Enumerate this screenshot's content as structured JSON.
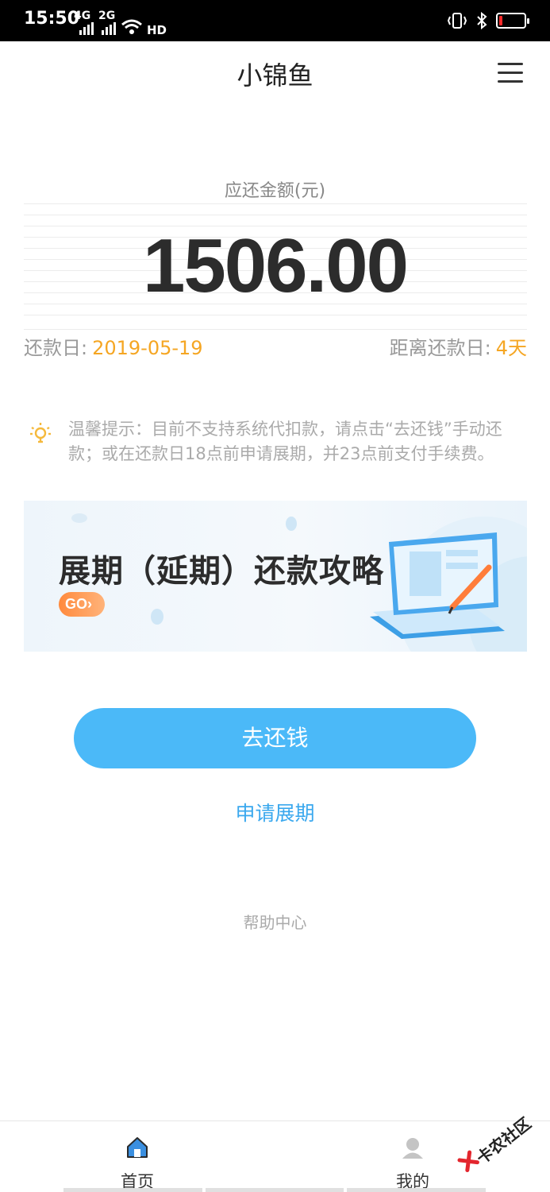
{
  "status_bar": {
    "time": "15:50",
    "signal_1": "4G",
    "signal_2": "2G",
    "hd_label": "HD",
    "battery_level": 0.12,
    "battery_color": "#ff2a2a"
  },
  "header": {
    "title": "小锦鱼",
    "menu_icon": "hamburger-menu-icon"
  },
  "amount": {
    "label": "应还金额(元)",
    "value": "1506.00"
  },
  "due": {
    "date_label": "还款日:",
    "date_value": "2019-05-19",
    "countdown_label": "距离还款日:",
    "countdown_value": "4天",
    "accent_color": "#f5a623"
  },
  "tip": {
    "icon": "lightbulb-icon",
    "text": "温馨提示：目前不支持系统代扣款，请点击“去还钱”手动还款；或在还款日18点前申请展期，并23点前支付手续费。"
  },
  "banner": {
    "title": "展期（延期）还款攻略",
    "go_label": "GO",
    "go_arrow": "›"
  },
  "actions": {
    "pay_label": "去还钱",
    "extend_label": "申请展期",
    "help_label": "帮助中心",
    "primary_color": "#4bb9f8"
  },
  "tabbar": {
    "home_label": "首页",
    "mine_label": "我的",
    "home_icon": "home-icon",
    "mine_icon": "user-icon"
  },
  "watermark": {
    "text": "卡农社区"
  }
}
